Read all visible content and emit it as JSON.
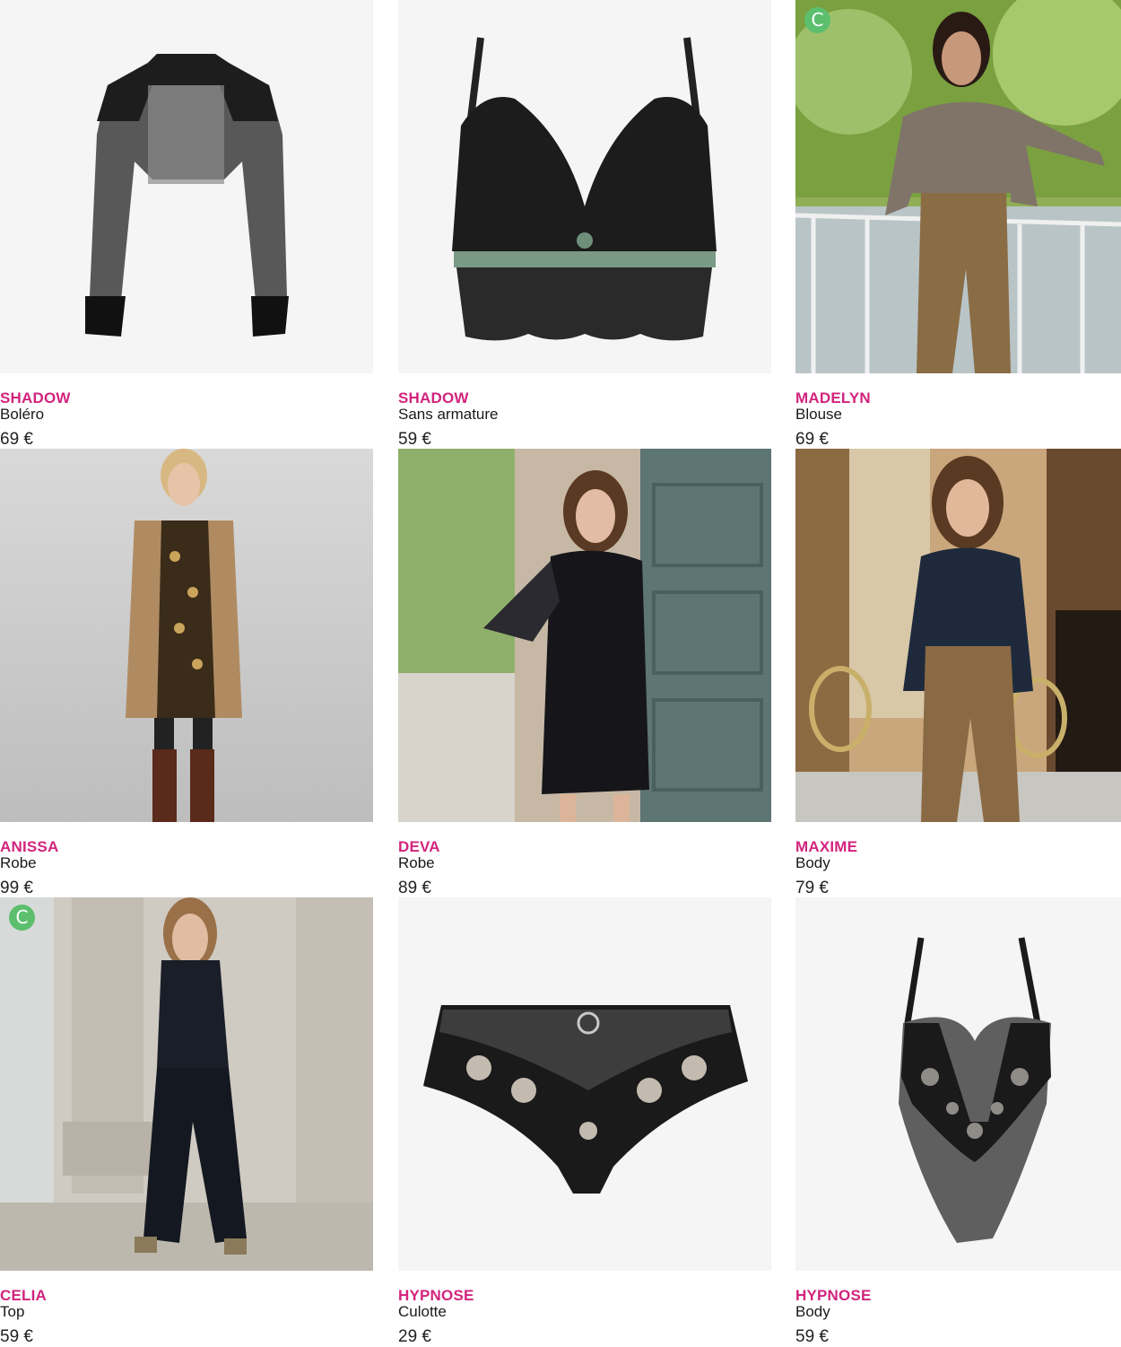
{
  "products": [
    {
      "brand": "SHADOW",
      "name": "Boléro",
      "price": "69 €",
      "image": "black-lace-bolero",
      "badge": ""
    },
    {
      "brand": "SHADOW",
      "name": "Sans armature",
      "price": "59 €",
      "image": "black-lace-bralette",
      "badge": ""
    },
    {
      "brand": "MADELYN",
      "name": "Blouse",
      "price": "69 €",
      "image": "model-printed-blouse",
      "badge": "C"
    },
    {
      "brand": "ANISSA",
      "name": "Robe",
      "price": "99 €",
      "image": "model-printed-dress-cardigan",
      "badge": ""
    },
    {
      "brand": "DEVA",
      "name": "Robe",
      "price": "89 €",
      "image": "model-black-lace-dress",
      "badge": ""
    },
    {
      "brand": "MAXIME",
      "name": "Body",
      "price": "79 €",
      "image": "model-navy-satin-body",
      "badge": ""
    },
    {
      "brand": "CELIA",
      "name": "Top",
      "price": "59 €",
      "image": "model-black-top-jeans",
      "badge": "C"
    },
    {
      "brand": "HYPNOSE",
      "name": "Culotte",
      "price": "29 €",
      "image": "black-lace-brief",
      "badge": ""
    },
    {
      "brand": "HYPNOSE",
      "name": "Body",
      "price": "59 €",
      "image": "black-lace-bodysuit",
      "badge": ""
    }
  ],
  "colors": {
    "brand": "#d2247d",
    "badge": "#5cbf6e",
    "product_bg": "#f5f5f5"
  }
}
